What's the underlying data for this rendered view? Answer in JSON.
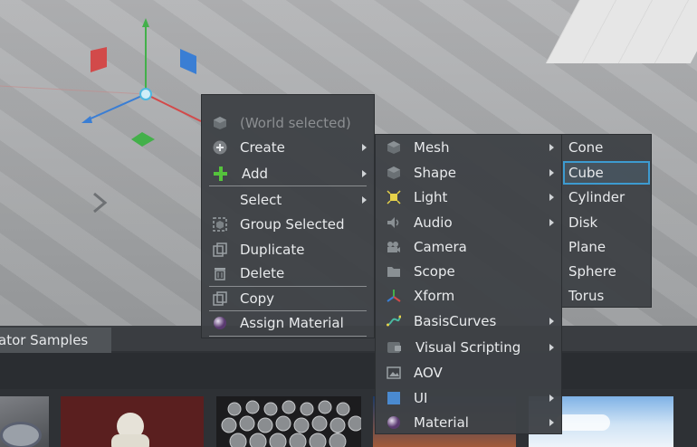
{
  "context_menu": {
    "items": [
      {
        "label": "(World selected)",
        "icon": "cube-icon"
      },
      {
        "label": "Create",
        "icon": "plus-circle-icon"
      },
      {
        "label": "Add",
        "icon": "plus-icon"
      },
      {
        "label": "Select",
        "icon": ""
      },
      {
        "label": "Group Selected",
        "icon": "group-icon"
      },
      {
        "label": "Duplicate",
        "icon": "duplicate-icon"
      },
      {
        "label": "Delete",
        "icon": "trash-icon"
      },
      {
        "label": "Copy",
        "icon": "copy-icon"
      },
      {
        "label": "Assign Material",
        "icon": "material-sphere-icon"
      }
    ]
  },
  "create_submenu": {
    "items": [
      {
        "label": "Mesh",
        "icon": "cube-icon"
      },
      {
        "label": "Shape",
        "icon": "cube-icon"
      },
      {
        "label": "Light",
        "icon": "light-icon"
      },
      {
        "label": "Audio",
        "icon": "speaker-icon"
      },
      {
        "label": "Camera",
        "icon": "camera-icon"
      },
      {
        "label": "Scope",
        "icon": "folder-icon"
      },
      {
        "label": "Xform",
        "icon": "axes-icon"
      },
      {
        "label": "BasisCurves",
        "icon": "curve-icon"
      },
      {
        "label": "Visual Scripting",
        "icon": "graph-icon"
      },
      {
        "label": "AOV",
        "icon": "image-icon"
      },
      {
        "label": "UI",
        "icon": "ui-square-icon"
      },
      {
        "label": "Material",
        "icon": "material-sphere-icon"
      }
    ]
  },
  "shape_submenu": {
    "items": [
      {
        "label": "Cone"
      },
      {
        "label": "Cube"
      },
      {
        "label": "Cylinder"
      },
      {
        "label": "Disk"
      },
      {
        "label": "Plane"
      },
      {
        "label": "Sphere"
      },
      {
        "label": "Torus"
      }
    ],
    "highlighted": "Cube"
  },
  "bottom_panel": {
    "tab_label": "ator Samples"
  },
  "colors": {
    "menu_bg": "#3e4246",
    "highlight": "#3d9bd0",
    "axis_x": "#d24a4a",
    "axis_y": "#43b04a",
    "axis_z": "#3a7ed4"
  }
}
